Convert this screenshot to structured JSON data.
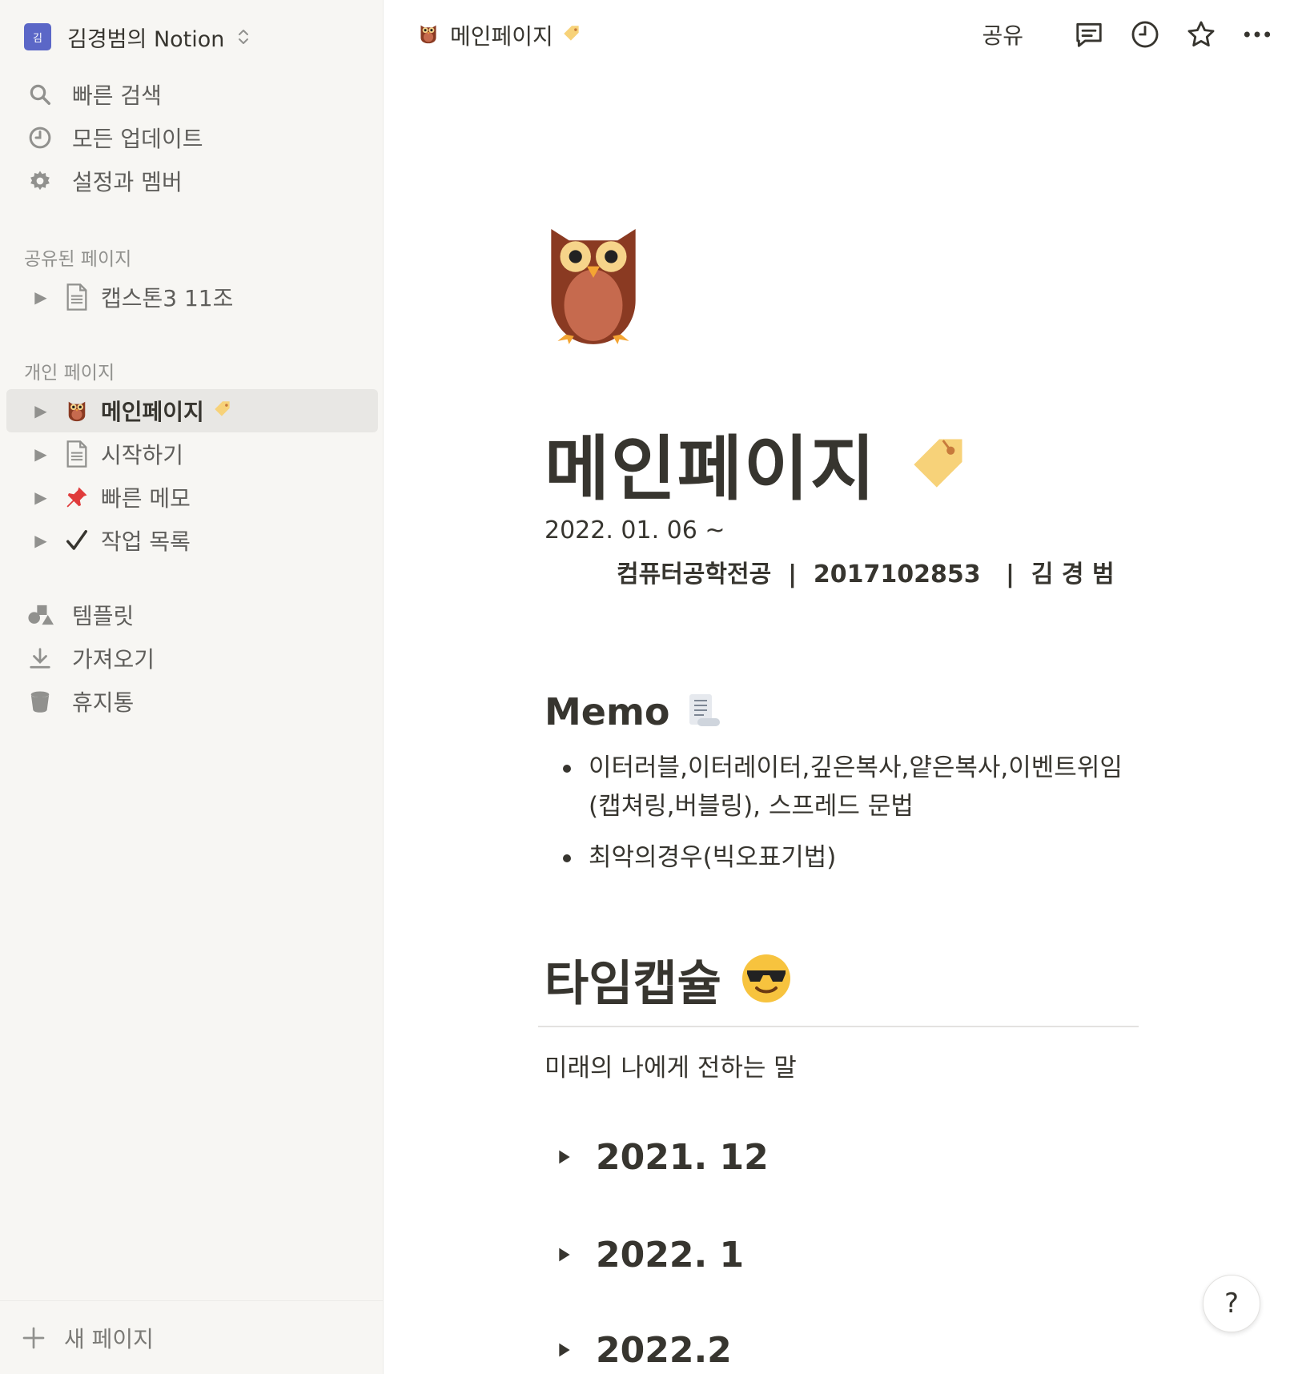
{
  "sidebar": {
    "workspace": {
      "avatar": "김",
      "name": "김경범의 Notion"
    },
    "nav": [
      {
        "label": "빠른 검색",
        "icon": "search-icon"
      },
      {
        "label": "모든 업데이트",
        "icon": "clock-icon"
      },
      {
        "label": "설정과 멤버",
        "icon": "gear-icon"
      }
    ],
    "shared_title": "공유된 페이지",
    "shared": [
      {
        "label": "캡스톤3 11조",
        "icon": "document-icon"
      }
    ],
    "private_title": "개인 페이지",
    "private": [
      {
        "label": "메인페이지",
        "icon": "owl-icon",
        "active": true
      },
      {
        "label": "시작하기",
        "icon": "document-icon"
      },
      {
        "label": "빠른 메모",
        "icon": "pushpin-icon"
      },
      {
        "label": "작업 목록",
        "icon": "checkmark-icon"
      }
    ],
    "tools": [
      {
        "label": "템플릿",
        "icon": "shapes-icon"
      },
      {
        "label": "가져오기",
        "icon": "download-icon"
      },
      {
        "label": "휴지통",
        "icon": "trash-icon"
      }
    ],
    "new_page": "새 페이지"
  },
  "topbar": {
    "breadcrumb": "메인페이지",
    "share": "공유"
  },
  "page": {
    "title": "메인페이지",
    "date": "2022.  01. 06 ~",
    "info": "컴퓨터공학전공  |  2017102853   |  김 경 범",
    "memo_heading": "Memo",
    "memo_items": [
      "이터러블,이터레이터,깊은복사,얕은복사,이벤트위임(캡쳐링,버블링), 스프레드 문법",
      "최악의경우(빅오표기법)"
    ],
    "timecapsule_heading": "타임캡슐",
    "timecapsule_sub": "미래의 나에게 전하는 말",
    "toggles": [
      "2021. 12",
      "2022. 1",
      "2022.2"
    ]
  },
  "help": "?",
  "colors": {
    "sidebar_bg": "#f7f6f3",
    "active_bg": "#e8e7e4",
    "text": "#37352f",
    "muted": "#91918e",
    "avatar": "#5b67c7"
  }
}
